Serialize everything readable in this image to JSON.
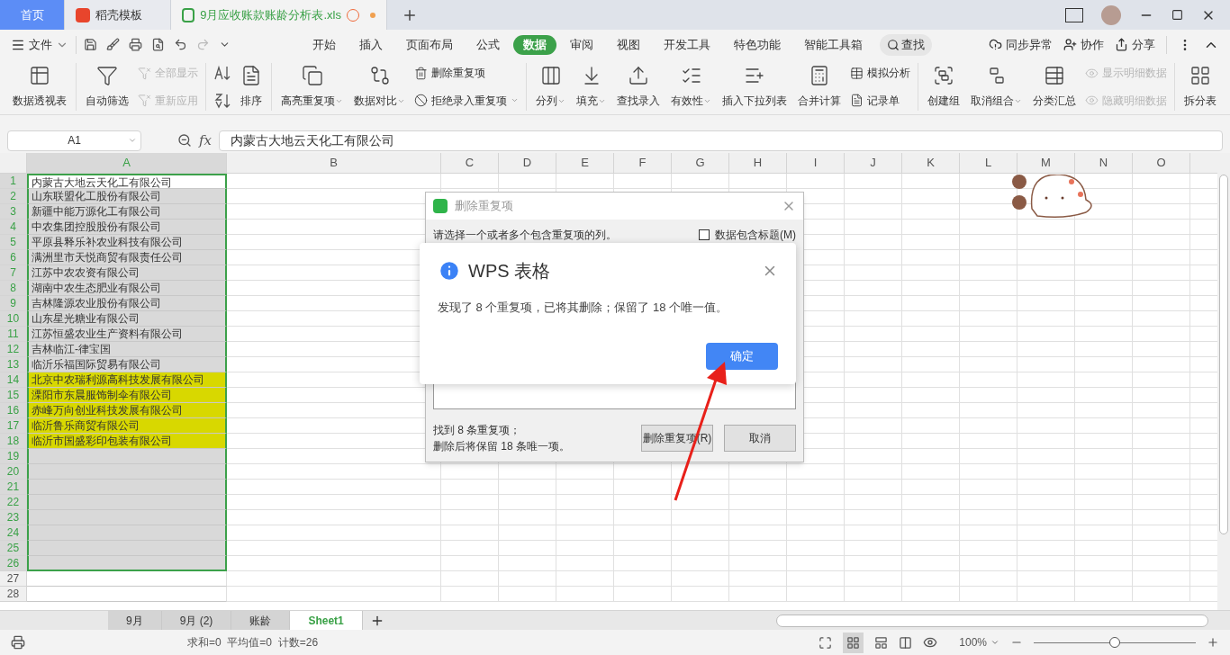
{
  "window_tabs": [
    {
      "label": "首页",
      "kind": "home",
      "selected": false
    },
    {
      "label": "稻壳模板",
      "kind": "docer",
      "selected": false
    },
    {
      "label": "9月应收账款账龄分析表.xls",
      "kind": "sheet",
      "selected": true,
      "modified": true
    }
  ],
  "menu": {
    "file": "文件",
    "tabs": [
      {
        "label": "开始",
        "selected": false
      },
      {
        "label": "插入",
        "selected": false
      },
      {
        "label": "页面布局",
        "selected": false
      },
      {
        "label": "公式",
        "selected": false
      },
      {
        "label": "数据",
        "selected": true
      },
      {
        "label": "审阅",
        "selected": false
      },
      {
        "label": "视图",
        "selected": false
      },
      {
        "label": "开发工具",
        "selected": false
      },
      {
        "label": "特色功能",
        "selected": false
      },
      {
        "label": "智能工具箱",
        "selected": false
      }
    ],
    "search": "查找",
    "right": [
      {
        "label": "同步异常",
        "kind": "sync"
      },
      {
        "label": "协作",
        "kind": "user"
      },
      {
        "label": "分享",
        "kind": "share"
      }
    ]
  },
  "ribbon": [
    {
      "kind": "large",
      "label": "数据透视表",
      "dropdown": false
    },
    {
      "kind": "sep"
    },
    {
      "kind": "large",
      "label": "自动筛选",
      "dropdown": false
    },
    {
      "kind": "pair",
      "items": [
        {
          "label": "全部显示",
          "disabled": true,
          "dropdown": false
        },
        {
          "label": "重新应用",
          "disabled": true,
          "dropdown": false
        }
      ]
    },
    {
      "kind": "sep"
    },
    {
      "kind": "sorticons"
    },
    {
      "kind": "large",
      "label": "排序",
      "dropdown": false
    },
    {
      "kind": "sep"
    },
    {
      "kind": "large",
      "label": "高亮重复项",
      "dropdown": true
    },
    {
      "kind": "large",
      "label": "数据对比",
      "dropdown": true
    },
    {
      "kind": "pair",
      "items": [
        {
          "label": "删除重复项",
          "disabled": false,
          "dropdown": false
        },
        {
          "label": "拒绝录入重复项",
          "disabled": false,
          "dropdown": true
        }
      ]
    },
    {
      "kind": "sep"
    },
    {
      "kind": "large",
      "label": "分列",
      "dropdown": true
    },
    {
      "kind": "large",
      "label": "填充",
      "dropdown": true
    },
    {
      "kind": "large",
      "label": "查找录入",
      "dropdown": false
    },
    {
      "kind": "large",
      "label": "有效性",
      "dropdown": true
    },
    {
      "kind": "large",
      "label": "插入下拉列表",
      "dropdown": false
    },
    {
      "kind": "large",
      "label": "合并计算",
      "dropdown": false
    },
    {
      "kind": "pair",
      "items": [
        {
          "label": "模拟分析",
          "disabled": false,
          "dropdown": false
        },
        {
          "label": "记录单",
          "disabled": false,
          "dropdown": false
        }
      ]
    },
    {
      "kind": "sep"
    },
    {
      "kind": "large",
      "label": "创建组",
      "dropdown": false
    },
    {
      "kind": "large",
      "label": "取消组合",
      "dropdown": true
    },
    {
      "kind": "large",
      "label": "分类汇总",
      "dropdown": false
    },
    {
      "kind": "pair",
      "items": [
        {
          "label": "显示明细数据",
          "disabled": true,
          "dropdown": false
        },
        {
          "label": "隐藏明细数据",
          "disabled": true,
          "dropdown": false
        }
      ]
    },
    {
      "kind": "sep"
    },
    {
      "kind": "large",
      "label": "拆分表",
      "dropdown": false
    }
  ],
  "formula_bar": {
    "cell": "A1",
    "fx": "fx",
    "value": "内蒙古大地云天化工有限公司"
  },
  "columns": [
    "A",
    "B",
    "C",
    "D",
    "E",
    "F",
    "G",
    "H",
    "I",
    "J",
    "K",
    "L",
    "M",
    "N",
    "O"
  ],
  "rows": [
    {
      "label": "1",
      "a": "内蒙古大地云天化工有限公司",
      "selected": true,
      "active": true,
      "highlighted": false
    },
    {
      "label": "2",
      "a": "山东联盟化工股份有限公司",
      "selected": true,
      "active": false,
      "highlighted": false
    },
    {
      "label": "3",
      "a": "新疆中能万源化工有限公司",
      "selected": true,
      "active": false,
      "highlighted": false
    },
    {
      "label": "4",
      "a": "中农集团控股股份有限公司",
      "selected": true,
      "active": false,
      "highlighted": false
    },
    {
      "label": "5",
      "a": "平原县释乐补农业科技有限公司",
      "selected": true,
      "active": false,
      "highlighted": false
    },
    {
      "label": "6",
      "a": "满洲里市天悦商贸有限责任公司",
      "selected": true,
      "active": false,
      "highlighted": false
    },
    {
      "label": "7",
      "a": "江苏中农农资有限公司",
      "selected": true,
      "active": false,
      "highlighted": false
    },
    {
      "label": "8",
      "a": "湖南中农生态肥业有限公司",
      "selected": true,
      "active": false,
      "highlighted": false
    },
    {
      "label": "9",
      "a": "吉林隆源农业股份有限公司",
      "selected": true,
      "active": false,
      "highlighted": false
    },
    {
      "label": "10",
      "a": "山东星光糖业有限公司",
      "selected": true,
      "active": false,
      "highlighted": false
    },
    {
      "label": "11",
      "a": "江苏恒盛农业生产资料有限公司",
      "selected": true,
      "active": false,
      "highlighted": false
    },
    {
      "label": "12",
      "a": "吉林临江-律宝国",
      "selected": true,
      "active": false,
      "highlighted": false
    },
    {
      "label": "13",
      "a": "临沂乐福国际贸易有限公司",
      "selected": true,
      "active": false,
      "highlighted": false
    },
    {
      "label": "14",
      "a": "北京中农瑞利源高科技发展有限公司",
      "selected": true,
      "active": false,
      "highlighted": true
    },
    {
      "label": "15",
      "a": "溧阳市东晨服饰制伞有限公司",
      "selected": true,
      "active": false,
      "highlighted": true
    },
    {
      "label": "16",
      "a": "赤峰万向创业科技发展有限公司",
      "selected": true,
      "active": false,
      "highlighted": true
    },
    {
      "label": "17",
      "a": "临沂鲁乐商贸有限公司",
      "selected": true,
      "active": false,
      "highlighted": true
    },
    {
      "label": "18",
      "a": "临沂市国盛彩印包装有限公司",
      "selected": true,
      "active": false,
      "highlighted": true
    },
    {
      "label": "19",
      "selected": true,
      "active": false,
      "highlighted": false
    },
    {
      "label": "20",
      "selected": true,
      "active": false,
      "highlighted": false
    },
    {
      "label": "21",
      "selected": true,
      "active": false,
      "highlighted": false
    },
    {
      "label": "22",
      "selected": true,
      "active": false,
      "highlighted": false
    },
    {
      "label": "23",
      "selected": true,
      "active": false,
      "highlighted": false
    },
    {
      "label": "24",
      "selected": true,
      "active": false,
      "highlighted": false
    },
    {
      "label": "25",
      "selected": true,
      "active": false,
      "highlighted": false
    },
    {
      "label": "26",
      "selected": true,
      "active": false,
      "highlighted": false
    },
    {
      "label": "27",
      "selected": false,
      "active": false,
      "highlighted": false
    },
    {
      "label": "28",
      "selected": false,
      "active": false,
      "highlighted": false
    }
  ],
  "dup_dialog": {
    "title": "删除重复项",
    "prompt": "请选择一个或者多个包含重复项的列。",
    "header_option": {
      "label": "数据包含标题(M)",
      "checked": false
    },
    "summary": [
      "找到 8 条重复项；",
      "删除后将保留 18 条唯一项。"
    ],
    "buttons": [
      "删除重复项(R)",
      "取消"
    ]
  },
  "message": {
    "title": "WPS 表格",
    "text": "发现了 8 个重复项，已将其删除；保留了 18 个唯一值。",
    "button": "确定"
  },
  "sheets": [
    {
      "label": "9月",
      "selected": false
    },
    {
      "label": "9月 (2)",
      "selected": false
    },
    {
      "label": "账龄",
      "selected": false
    },
    {
      "label": "Sheet1",
      "selected": true
    }
  ],
  "status": {
    "stats": "求和=0  平均值=0  计数=26",
    "zoom": "100%",
    "zoom_slider": {
      "level": 0.5
    }
  }
}
